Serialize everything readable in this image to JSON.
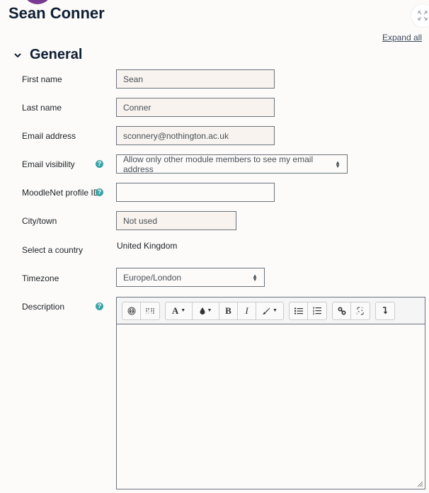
{
  "header": {
    "title": "Sean Conner",
    "expand_all": "Expand all"
  },
  "section": {
    "title": "General"
  },
  "fields": {
    "first_name": {
      "label": "First name",
      "value": "Sean"
    },
    "last_name": {
      "label": "Last name",
      "value": "Conner"
    },
    "email": {
      "label": "Email address",
      "value": "sconnery@nothington.ac.uk"
    },
    "email_visibility": {
      "label": "Email visibility",
      "value": "Allow only other module members to see my email address"
    },
    "moodlenet": {
      "label": "MoodleNet profile ID",
      "value": ""
    },
    "city": {
      "label": "City/town",
      "value": "Not used"
    },
    "country": {
      "label": "Select a country",
      "value": "United Kingdom"
    },
    "timezone": {
      "label": "Timezone",
      "value": "Europe/London"
    },
    "description": {
      "label": "Description",
      "value": ""
    }
  },
  "help_glyph": "?",
  "toolbar": {
    "font_label": "A",
    "bold_label": "B",
    "italic_label": "I"
  },
  "colors": {
    "accent_help": "#3aa3a8",
    "title": "#0f1f33",
    "readonly_bg": "#f8f3ee"
  }
}
